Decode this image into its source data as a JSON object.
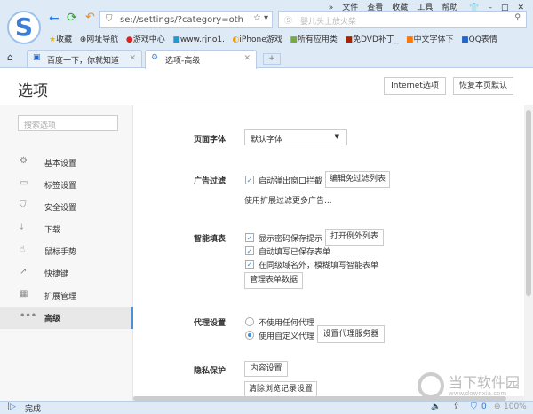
{
  "menu": [
    "»",
    "文件",
    "查看",
    "收藏",
    "工具",
    "帮助"
  ],
  "address": "se://settings/?category=oth",
  "search_placeholder": "婴儿头上放火柴",
  "bookmarks": [
    "收藏",
    "网址导航",
    "游戏中心",
    "www.rjno1.",
    "iPhone游戏",
    "所有应用类",
    "免DVD补丁_",
    "中文字体下",
    "QQ表情"
  ],
  "tabs": [
    {
      "label": "百度一下，你就知道"
    },
    {
      "label": "选项-高级"
    }
  ],
  "page_title": "选项",
  "header_buttons": {
    "internet": "Internet选项",
    "restore": "恢复本页默认"
  },
  "sidebar": {
    "search_placeholder": "搜索选项",
    "items": [
      {
        "label": "基本设置",
        "icon": "⚙"
      },
      {
        "label": "标签设置",
        "icon": "▭"
      },
      {
        "label": "安全设置",
        "icon": "⛉"
      },
      {
        "label": "下载",
        "icon": "⤓"
      },
      {
        "label": "鼠标手势",
        "icon": "☝"
      },
      {
        "label": "快捷键",
        "icon": "↗"
      },
      {
        "label": "扩展管理",
        "icon": "▦"
      },
      {
        "label": "高级",
        "icon": "•••"
      }
    ]
  },
  "font": {
    "label": "页面字体",
    "value": "默认字体"
  },
  "adfilter": {
    "label": "广告过滤",
    "check": "启动弹出窗口拦截",
    "button": "编辑免过滤列表",
    "link": "使用扩展过滤更多广告..."
  },
  "autofill": {
    "label": "智能填表",
    "checks": [
      "显示密码保存提示",
      "自动填写已保存表单",
      "在同级域名外，模糊填写智能表单"
    ],
    "button1": "打开例外列表",
    "button2": "管理表单数据"
  },
  "proxy": {
    "label": "代理设置",
    "options": [
      "不使用任何代理",
      "使用自定义代理"
    ],
    "button": "设置代理服务器"
  },
  "privacy": {
    "label": "隐私保护",
    "button1": "内容设置",
    "button2": "清除浏览记录设置"
  },
  "status": {
    "text": "完成",
    "count": "0",
    "zoom": "100%"
  },
  "watermark": {
    "name": "当下软件园",
    "url": "www.downxia.com"
  }
}
